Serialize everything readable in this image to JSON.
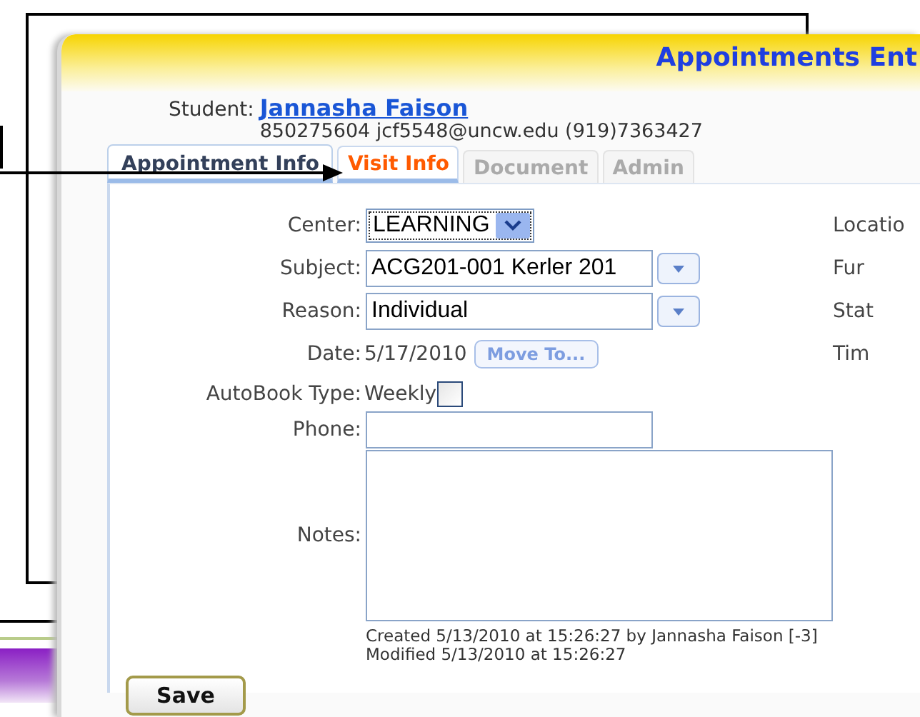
{
  "window": {
    "title": "Appointments Ent"
  },
  "student": {
    "label": "Student:",
    "name": "Jannasha Faison",
    "details": "850275604 jcf5548@uncw.edu (919)7363427"
  },
  "tabs": [
    {
      "label": "Appointment Info",
      "selected": true,
      "highlighted": false
    },
    {
      "label": "Visit Info",
      "selected": false,
      "highlighted": true
    },
    {
      "label": "Document",
      "selected": false,
      "highlighted": false
    },
    {
      "label": "Admin",
      "selected": false,
      "highlighted": false
    }
  ],
  "fields": [
    {
      "kind": "select",
      "label": "Center:",
      "value": "LEARNING",
      "side_label": "Locatio"
    },
    {
      "kind": "combo",
      "label": "Subject:",
      "value": "ACG201-001 Kerler 201",
      "side_label": "Fur"
    },
    {
      "kind": "combo",
      "label": "Reason:",
      "value": "Individual",
      "side_label": "Stat"
    },
    {
      "kind": "date",
      "label": "Date:",
      "value": "5/17/2010",
      "button": "Move To...",
      "side_label": "Tim"
    },
    {
      "kind": "checkbox",
      "label": "AutoBook Type:",
      "value": "Weekly",
      "checked": false
    },
    {
      "kind": "text",
      "label": "Phone:"
    },
    {
      "kind": "textarea",
      "label": "Notes:"
    }
  ],
  "audit": [
    "Created 5/13/2010 at 15:26:27 by Jannasha Faison [-3]",
    "Modified 5/13/2010 at 15:26:27"
  ],
  "save_button": "Save"
}
